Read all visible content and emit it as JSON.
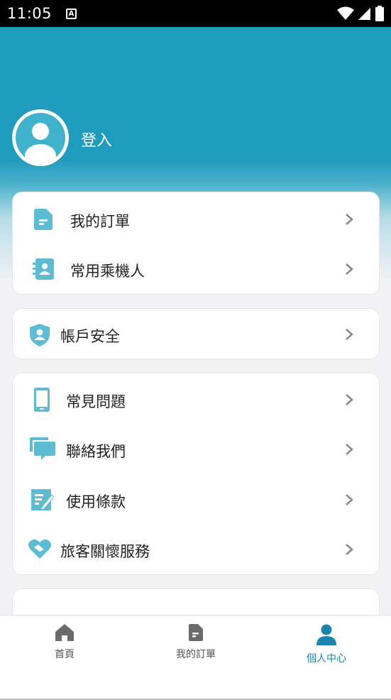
{
  "status_bar": {
    "time": "11:05",
    "notification_icon": "A"
  },
  "profile": {
    "login_label": "登入"
  },
  "card_orders": {
    "items": [
      {
        "label": "我的訂單",
        "icon": "document-icon"
      },
      {
        "label": "常用乘機人",
        "icon": "contact-book-icon"
      }
    ]
  },
  "card_account": {
    "items": [
      {
        "label": "帳戶安全",
        "icon": "shield-user-icon"
      }
    ]
  },
  "card_support": {
    "items": [
      {
        "label": "常見問題",
        "icon": "phone-icon"
      },
      {
        "label": "聯絡我們",
        "icon": "chat-bubbles-icon"
      },
      {
        "label": "使用條款",
        "icon": "edit-note-icon"
      },
      {
        "label": "旅客關懷服務",
        "icon": "heart-hands-icon"
      }
    ]
  },
  "bottom_nav": {
    "items": [
      {
        "label": "首頁",
        "icon": "home-icon"
      },
      {
        "label": "我的訂單",
        "icon": "document-icon"
      },
      {
        "label": "個人中心",
        "icon": "person-icon",
        "active": true
      }
    ]
  },
  "colors": {
    "accent": "#1f9bbd",
    "icon_teal": "#5bbcd3",
    "active_nav": "#1a86b0"
  }
}
